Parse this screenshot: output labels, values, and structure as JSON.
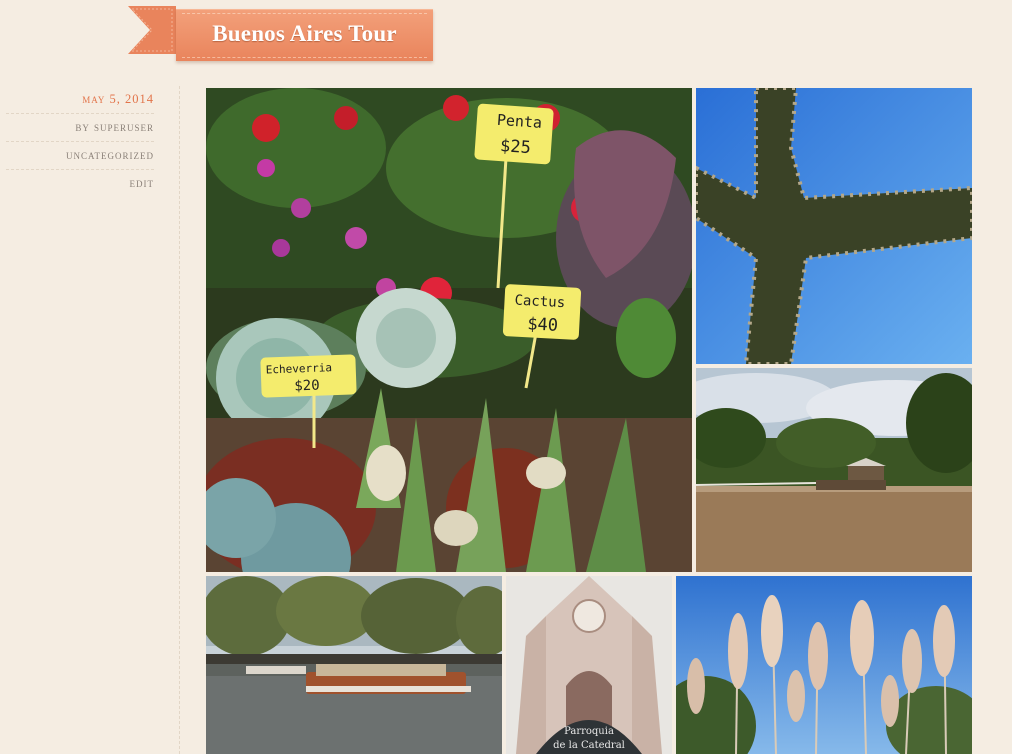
{
  "post": {
    "title": "Buenos Aires Tour"
  },
  "meta": {
    "date": "May 5, 2014",
    "author": "by superuser",
    "category": "Uncategorized",
    "edit": "Edit"
  },
  "photos": {
    "flowers": {
      "sign1": "Penta",
      "price1": "$25",
      "sign2": "Cactus",
      "price2": "$40",
      "sign3": "Echeverria",
      "price3": "$20"
    },
    "church_sign_line1": "Parroquia",
    "church_sign_line2": "de la Catedral"
  },
  "colors": {
    "accent": "#e9845c",
    "background": "#f5ede2",
    "meta_text": "#8a8078"
  }
}
